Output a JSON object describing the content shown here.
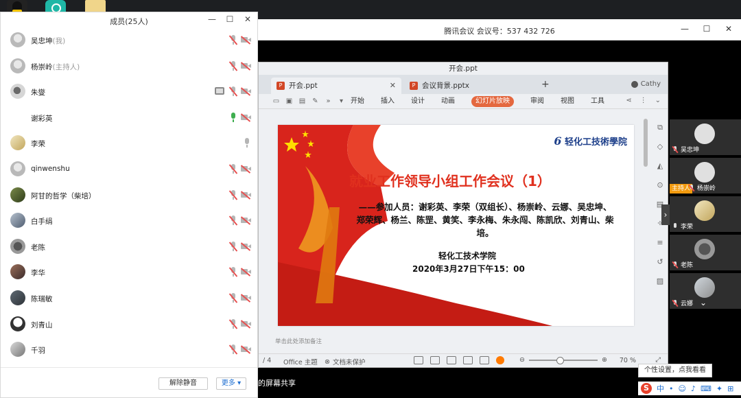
{
  "meeting": {
    "title": "腾讯会议 会议号：537 432 726",
    "share_text": "的屏幕共享",
    "win_min": "—",
    "win_max": "☐",
    "win_close": "✕"
  },
  "members_panel": {
    "title": "成员(25人)",
    "members": [
      {
        "name": "吴忠坤",
        "role": "(我)",
        "mic": "muted",
        "cam": "off"
      },
      {
        "name": "杨崇岭",
        "role": "(主持人)",
        "mic": "muted",
        "cam": "off"
      },
      {
        "name": "朱燮",
        "role": "",
        "mic": "muted",
        "cam": "off",
        "sharing": true
      },
      {
        "name": "谢彩英",
        "role": "",
        "mic": "on",
        "cam": "off"
      },
      {
        "name": "李荣",
        "role": "",
        "mic": "on_idle",
        "cam": "none"
      },
      {
        "name": "qinwenshu",
        "role": "",
        "mic": "muted",
        "cam": "off"
      },
      {
        "name": "阿甘的哲学（柴培）",
        "role": "",
        "mic": "muted",
        "cam": "off"
      },
      {
        "name": "白手绢",
        "role": "",
        "mic": "muted",
        "cam": "off"
      },
      {
        "name": "老陈",
        "role": "",
        "mic": "muted",
        "cam": "off"
      },
      {
        "name": "李华",
        "role": "",
        "mic": "muted",
        "cam": "off"
      },
      {
        "name": "陈瑞敏",
        "role": "",
        "mic": "muted",
        "cam": "off"
      },
      {
        "name": "刘青山",
        "role": "",
        "mic": "muted",
        "cam": "off"
      },
      {
        "name": "千羽",
        "role": "",
        "mic": "muted",
        "cam": "off"
      }
    ],
    "unmute_label": "解除静音",
    "more_label": "更多 ▾"
  },
  "wps": {
    "window_title": "开会.ppt",
    "tabs": [
      {
        "label": "开会.ppt"
      },
      {
        "label": "会议背景.pptx"
      }
    ],
    "user": "Cathy",
    "menu": [
      "开始",
      "插入",
      "设计",
      "动画",
      "幻灯片放映",
      "审阅",
      "视图",
      "工具"
    ],
    "menu_active": "幻灯片放映",
    "notes_hint": "单击此处添加备注",
    "status": {
      "page": "/ 4",
      "theme": "Office 主题",
      "protect": "文档未保护",
      "zoom": "70 %"
    }
  },
  "slide": {
    "logo": "轻化工技術學院",
    "title": "就业工作领导小组工作会议（1）",
    "attendees": "——参加人员：谢彩英、李荣（双组长）、杨崇岭、云娜、吴忠坤、郑荣辉、杨兰、陈罡、黄笑、李永梅、朱永闯、陈凯欣、刘青山、柴培。",
    "school": "轻化工技术学院",
    "date": "2020年3月27日下午15：00"
  },
  "video_strip": {
    "tiles": [
      {
        "name": "吴忠坤",
        "mic": "muted"
      },
      {
        "name": "杨崇岭",
        "mic": "muted",
        "badge": "主持人"
      },
      {
        "name": "李荣",
        "mic": "on"
      },
      {
        "name": "老陈",
        "mic": "muted"
      },
      {
        "name": "云娜",
        "mic": "muted"
      }
    ]
  },
  "tray": {
    "tooltip": "个性设置，点我看看",
    "ime_label": "中"
  },
  "colors": {
    "muted_red": "#e85050",
    "mic_green": "#3fae4f",
    "slide_title_red": "#e0301e",
    "menu_highlight": "#e4683f",
    "host_orange": "#f29a0e"
  }
}
